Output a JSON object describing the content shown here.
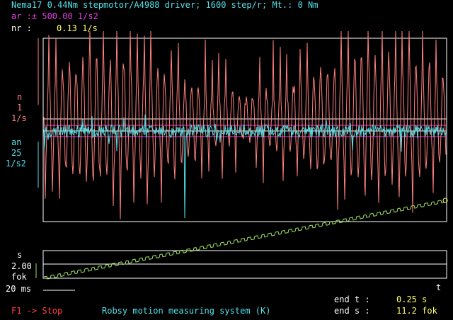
{
  "header": {
    "title": "Nema17 0.44Nm stepmotor/A4988 driver; 1600 step/r; Mt.: 0 Nm",
    "ar_label": "ar :± 500.00 1/s2",
    "nr_label": "nr :",
    "nr_value": "0.13 1/s"
  },
  "axis_left": {
    "n_label": "n",
    "n_scale": "1",
    "n_unit": "1/s",
    "an_label": "an",
    "an_scale": "25",
    "an_unit": "1/s2",
    "s_label": "s",
    "s_scale": "2.00",
    "s_unit": "fok"
  },
  "footer": {
    "time_scale": "20 ms",
    "t_axis": "t",
    "end_t_label": "end t :",
    "end_t_value": "0.25 s",
    "end_s_label": "end s :",
    "end_s_value": "11.2 fok",
    "stop_label": "F1 -> Stop",
    "system_label": "Robsy motion measuring system (K)"
  },
  "colors": {
    "title": "#55e0e8",
    "ar": "#e040e0",
    "speed": "#ff8080",
    "accel": "#55e0e8",
    "position": "#a0e060",
    "frame": "#ffffff",
    "stop": "#ff4040",
    "values": "#ffff66"
  }
}
